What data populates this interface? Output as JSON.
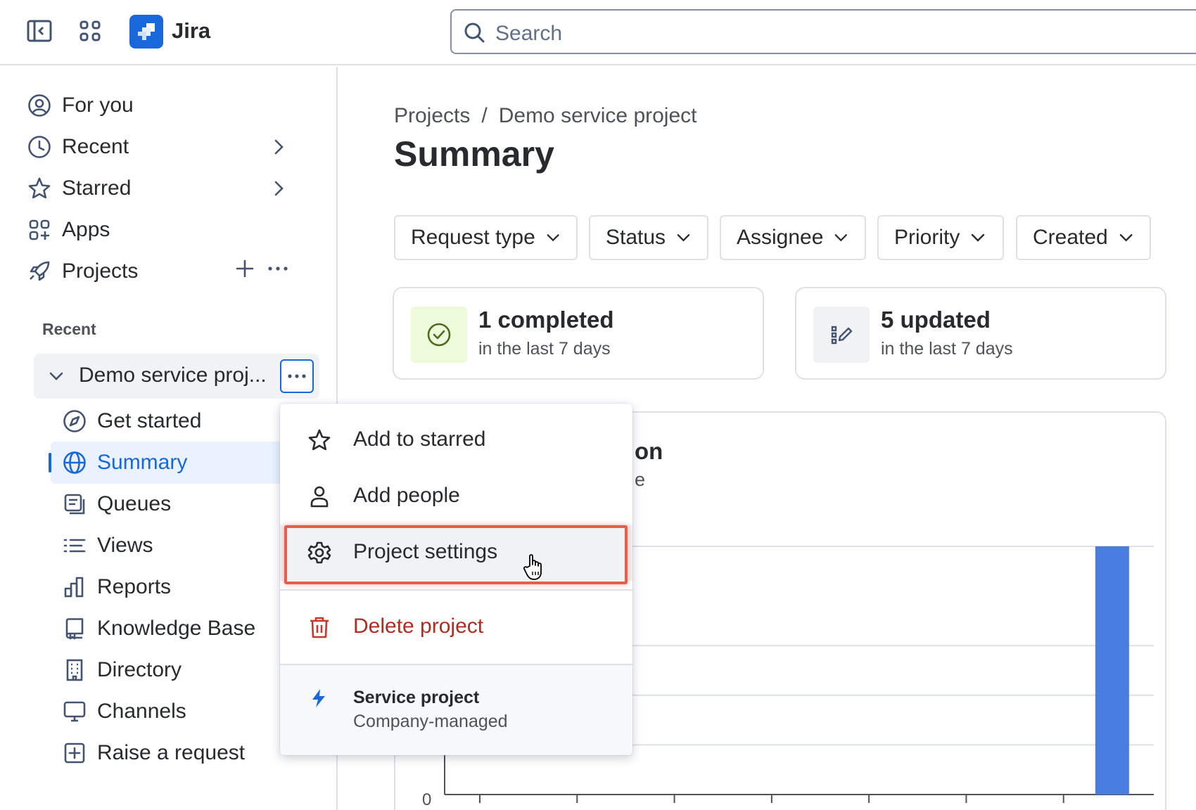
{
  "app": {
    "name": "Jira"
  },
  "search": {
    "placeholder": "Search"
  },
  "sidebar": {
    "items": [
      {
        "label": "For you",
        "icon": "user-circle-icon"
      },
      {
        "label": "Recent",
        "icon": "clock-icon"
      },
      {
        "label": "Starred",
        "icon": "star-icon"
      },
      {
        "label": "Apps",
        "icon": "apps-icon"
      },
      {
        "label": "Projects",
        "icon": "rocket-icon"
      }
    ],
    "recent_label": "Recent",
    "project": {
      "label": "Demo service proj..."
    },
    "project_items": [
      {
        "label": "Get started",
        "icon": "compass-icon"
      },
      {
        "label": "Summary",
        "icon": "globe-icon"
      },
      {
        "label": "Queues",
        "icon": "queues-icon"
      },
      {
        "label": "Views",
        "icon": "list-icon"
      },
      {
        "label": "Reports",
        "icon": "bar-chart-icon"
      },
      {
        "label": "Knowledge Base",
        "icon": "book-icon"
      },
      {
        "label": "Directory",
        "icon": "building-icon"
      },
      {
        "label": "Channels",
        "icon": "monitor-icon"
      },
      {
        "label": "Raise a request",
        "icon": "plus-square-icon"
      }
    ]
  },
  "breadcrumb": {
    "projects": "Projects",
    "separator": "/",
    "current": "Demo service project"
  },
  "page": {
    "title": "Summary"
  },
  "filters": [
    "Request type",
    "Status",
    "Assignee",
    "Priority",
    "Created"
  ],
  "stats": [
    {
      "value": "1 completed",
      "period": "in the last 7 days"
    },
    {
      "value": "5 updated",
      "period": "in the last 7 days"
    }
  ],
  "chart_card": {
    "title_fragment": "on",
    "subtitle_fragment": "e",
    "y_axis_zero": "0"
  },
  "chart_data": {
    "type": "bar",
    "values": [
      0,
      0,
      0,
      0,
      0,
      0,
      1
    ]
  },
  "menu": {
    "items": [
      {
        "label": "Add to starred",
        "icon": "star-icon"
      },
      {
        "label": "Add people",
        "icon": "person-icon"
      },
      {
        "label": "Project settings",
        "icon": "gear-icon"
      },
      {
        "label": "Delete project",
        "icon": "trash-icon"
      }
    ],
    "footer": {
      "title": "Service project",
      "subtitle": "Company-managed"
    }
  },
  "colors": {
    "accent": "#1868db",
    "danger": "#ae2e24",
    "highlight": "#e5604c",
    "completed_badge": "#eefbda",
    "bar": "#4a7de0"
  }
}
